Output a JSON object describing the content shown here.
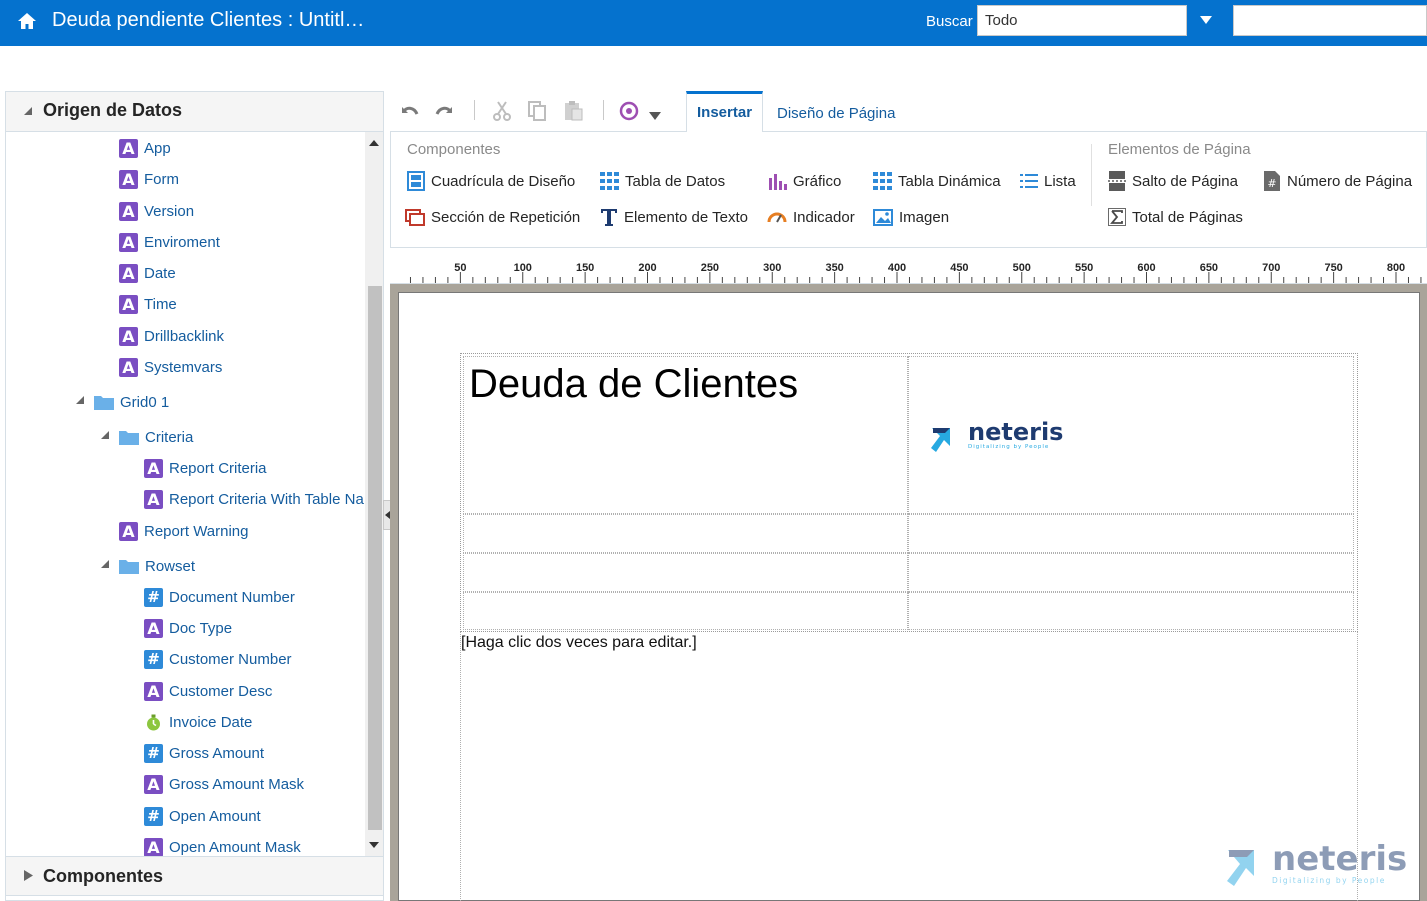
{
  "header": {
    "title": "Deuda pendiente Clientes : Untitl…",
    "search_label": "Buscar",
    "search_scope": "Todo",
    "search_value": ""
  },
  "data_source_panel": {
    "title": "Origen de Datos",
    "items": [
      {
        "label": "App",
        "icon": "text-field-icon"
      },
      {
        "label": "Form",
        "icon": "text-field-icon"
      },
      {
        "label": "Version",
        "icon": "text-field-icon"
      },
      {
        "label": "Enviroment",
        "icon": "text-field-icon"
      },
      {
        "label": "Date",
        "icon": "text-field-icon"
      },
      {
        "label": "Time",
        "icon": "text-field-icon"
      },
      {
        "label": "Drillbacklink",
        "icon": "text-field-icon"
      },
      {
        "label": "Systemvars",
        "icon": "text-field-icon"
      },
      {
        "label": "Grid0 1",
        "icon": "folder-icon"
      },
      {
        "label": "Criteria",
        "icon": "folder-icon"
      },
      {
        "label": "Report Criteria",
        "icon": "text-field-icon"
      },
      {
        "label": "Report Criteria With Table Na",
        "icon": "text-field-icon"
      },
      {
        "label": "Report Warning",
        "icon": "text-field-icon"
      },
      {
        "label": "Rowset",
        "icon": "folder-icon"
      },
      {
        "label": "Document Number",
        "icon": "number-field-icon"
      },
      {
        "label": "Doc Type",
        "icon": "text-field-icon"
      },
      {
        "label": "Customer Number",
        "icon": "number-field-icon"
      },
      {
        "label": "Customer Desc",
        "icon": "text-field-icon"
      },
      {
        "label": "Invoice Date",
        "icon": "date-field-icon"
      },
      {
        "label": "Gross Amount",
        "icon": "number-field-icon"
      },
      {
        "label": "Gross Amount Mask",
        "icon": "text-field-icon"
      },
      {
        "label": "Open Amount",
        "icon": "number-field-icon"
      },
      {
        "label": "Open Amount Mask",
        "icon": "text-field-icon"
      }
    ]
  },
  "components_panel": {
    "title": "Componentes"
  },
  "tabs": {
    "insert": "Insertar",
    "page_design": "Diseño de Página"
  },
  "ribbon": {
    "components_title": "Componentes",
    "page_elements_title": "Elementos de Página",
    "layout_grid": "Cuadrícula de Diseño",
    "data_table": "Tabla de Datos",
    "chart": "Gráfico",
    "pivot_table": "Tabla Dinámica",
    "list": "Lista",
    "repeating_section": "Sección de Repetición",
    "text_item": "Elemento de Texto",
    "gauge": "Indicador",
    "image": "Imagen",
    "page_break": "Salto de Página",
    "page_number": "Número de Página",
    "total_pages": "Total de Páginas"
  },
  "ruler": {
    "labels": [
      "50",
      "100",
      "150",
      "200",
      "250",
      "300",
      "350",
      "400",
      "450",
      "500",
      "550",
      "600",
      "650",
      "700",
      "750",
      "800"
    ]
  },
  "canvas": {
    "report_title": "Deuda de Clientes",
    "logo_text": "neteris",
    "logo_tagline": "Digitalizing by People",
    "placeholder_text": "[Haga clic dos veces para editar.]"
  },
  "colors": {
    "brand_blue": "#0572ce",
    "link_blue": "#145c9e",
    "text_icon": "#7a4ec2",
    "number_icon": "#2e8ad8",
    "logo_navy": "#1e3b70",
    "logo_cyan": "#27a9e1"
  }
}
